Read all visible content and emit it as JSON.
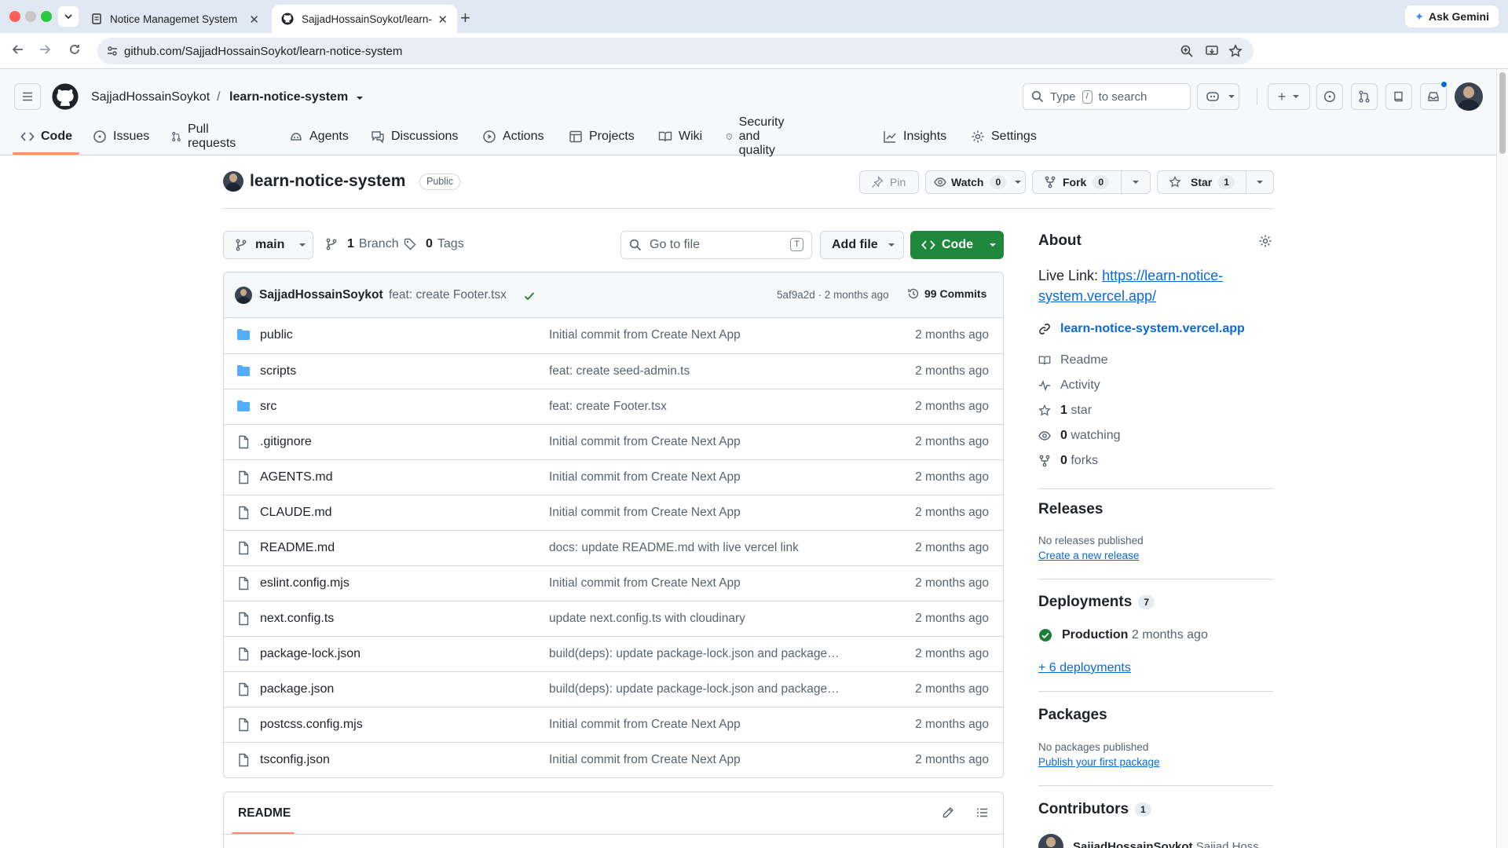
{
  "browser": {
    "tabs": [
      {
        "title": "Notice Managemet System"
      },
      {
        "title": "SajjadHossainSoykot/learn-no"
      }
    ],
    "url": "github.com/SajjadHossainSoykot/learn-notice-system",
    "ask_gemini": "Ask Gemini"
  },
  "header": {
    "owner": "SajjadHossainSoykot",
    "separator": "/",
    "repo": "learn-notice-system",
    "search_type": "Type",
    "search_key": "/",
    "search_rest": "to search"
  },
  "nav": {
    "items": [
      {
        "label": "Code",
        "icon": "code-icon"
      },
      {
        "label": "Issues",
        "icon": "issue-icon"
      },
      {
        "label": "Pull requests",
        "icon": "pull-request-icon"
      },
      {
        "label": "Agents",
        "icon": "agents-icon"
      },
      {
        "label": "Discussions",
        "icon": "discussions-icon"
      },
      {
        "label": "Actions",
        "icon": "play-icon"
      },
      {
        "label": "Projects",
        "icon": "table-icon"
      },
      {
        "label": "Wiki",
        "icon": "book-icon"
      },
      {
        "label": "Security and quality",
        "icon": "shield-icon"
      },
      {
        "label": "Insights",
        "icon": "graph-icon"
      },
      {
        "label": "Settings",
        "icon": "gear-icon"
      }
    ]
  },
  "repo": {
    "title": "learn-notice-system",
    "visibility": "Public",
    "pin": "Pin",
    "watch": "Watch",
    "watch_count": "0",
    "fork": "Fork",
    "fork_count": "0",
    "star": "Star",
    "star_count": "1"
  },
  "browser_controls": {
    "branch": "main",
    "branches_count": "1",
    "branches_label": "Branch",
    "tags_count": "0",
    "tags_label": "Tags",
    "goto_placeholder": "Go to file",
    "goto_key": "T",
    "add_file": "Add file",
    "code": "Code"
  },
  "commit": {
    "author": "SajjadHossainSoykot",
    "message": "feat: create Footer.tsx",
    "hash_time": "5af9a2d · 2 months ago",
    "count": "99 Commits"
  },
  "files": [
    {
      "name": "public",
      "type": "folder",
      "message": "Initial commit from Create Next App",
      "date": "2 months ago"
    },
    {
      "name": "scripts",
      "type": "folder",
      "message": "feat: create seed-admin.ts",
      "date": "2 months ago"
    },
    {
      "name": "src",
      "type": "folder",
      "message": "feat: create Footer.tsx",
      "date": "2 months ago"
    },
    {
      "name": ".gitignore",
      "type": "file",
      "message": "Initial commit from Create Next App",
      "date": "2 months ago"
    },
    {
      "name": "AGENTS.md",
      "type": "file",
      "message": "Initial commit from Create Next App",
      "date": "2 months ago"
    },
    {
      "name": "CLAUDE.md",
      "type": "file",
      "message": "Initial commit from Create Next App",
      "date": "2 months ago"
    },
    {
      "name": "README.md",
      "type": "file",
      "message": "docs: update README.md with live vercel link",
      "date": "2 months ago"
    },
    {
      "name": "eslint.config.mjs",
      "type": "file",
      "message": "Initial commit from Create Next App",
      "date": "2 months ago"
    },
    {
      "name": "next.config.ts",
      "type": "file",
      "message": "update next.config.ts with cloudinary",
      "date": "2 months ago"
    },
    {
      "name": "package-lock.json",
      "type": "file",
      "message": "build(deps): update package-lock.json and package.json F...",
      "date": "2 months ago"
    },
    {
      "name": "package.json",
      "type": "file",
      "message": "build(deps): update package-lock.json and package.json F...",
      "date": "2 months ago"
    },
    {
      "name": "postcss.config.mjs",
      "type": "file",
      "message": "Initial commit from Create Next App",
      "date": "2 months ago"
    },
    {
      "name": "tsconfig.json",
      "type": "file",
      "message": "Initial commit from Create Next App",
      "date": "2 months ago"
    }
  ],
  "readme": {
    "tab": "README"
  },
  "about": {
    "heading": "About",
    "live_label": "Live Link:",
    "live_url_1": "https://learn-notice-",
    "live_url_2": "system.vercel.app/",
    "website": "learn-notice-system.vercel.app",
    "readme": "Readme",
    "activity": "Activity",
    "stars_count": "1",
    "stars_label": "star",
    "watching_count": "0",
    "watching_label": "watching",
    "forks_count": "0",
    "forks_label": "forks"
  },
  "releases": {
    "heading": "Releases",
    "empty": "No releases published",
    "link": "Create a new release"
  },
  "deployments": {
    "heading": "Deployments",
    "count": "7",
    "env": "Production",
    "time": "2 months ago",
    "more": "+ 6 deployments"
  },
  "packages": {
    "heading": "Packages",
    "empty": "No packages published",
    "link": "Publish your first package"
  },
  "contributors": {
    "heading": "Contributors",
    "count": "1",
    "first": "SajjadHossainSoykot",
    "first_extra": "Sajjad Hoss"
  },
  "colors": {
    "accent_green": "#1f883d",
    "link_blue": "#0969da",
    "folder_blue": "#54aeff",
    "tab_underline": "#fd8c73"
  }
}
